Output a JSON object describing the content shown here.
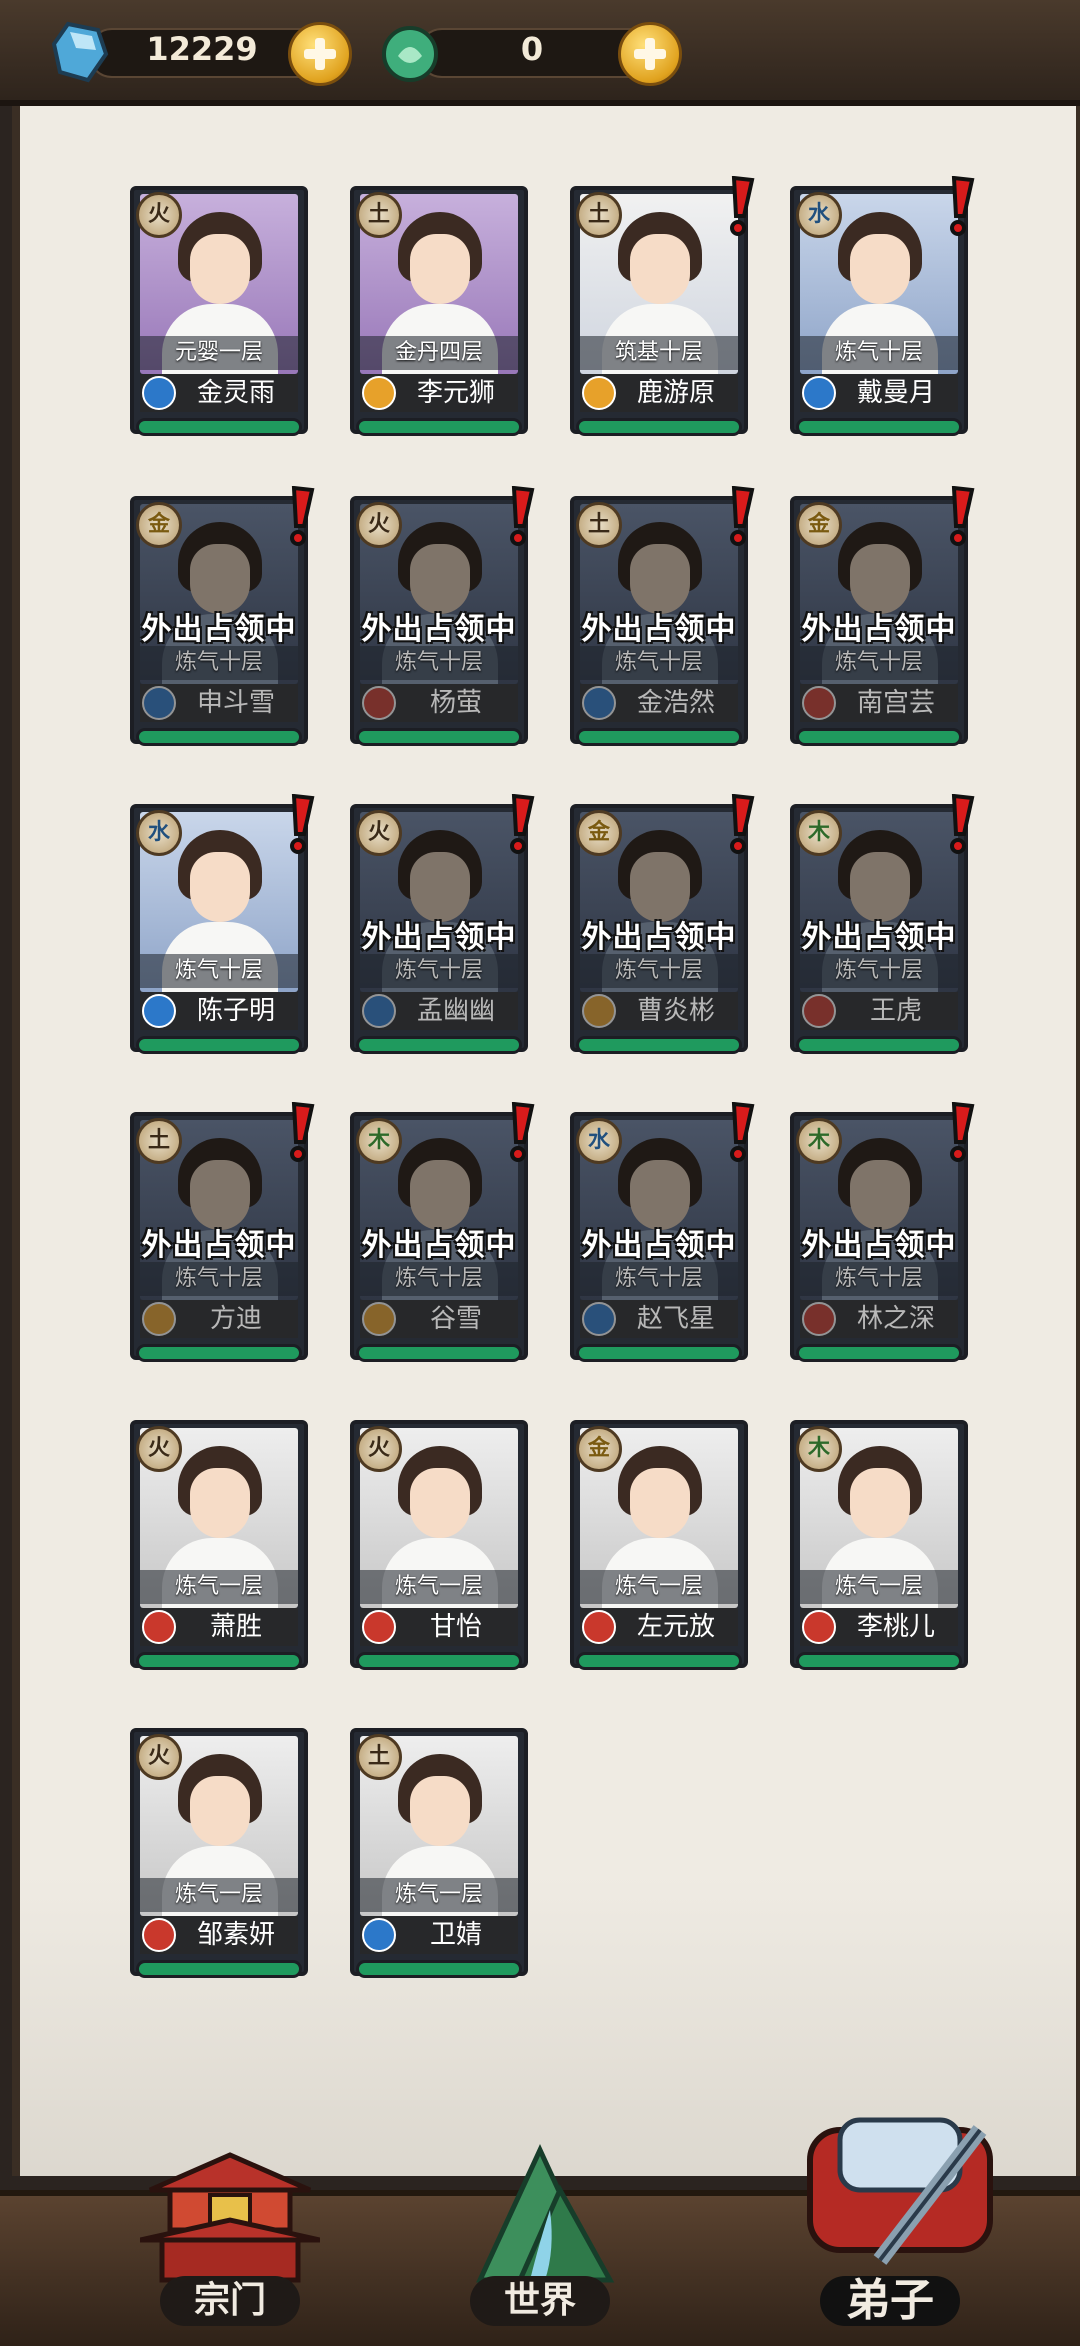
{
  "currency": {
    "jade_value": "12229",
    "jade_icon": "blue-crystal-icon",
    "gem_value": "0",
    "gem_icon": "green-egg-icon"
  },
  "disciples": [
    {
      "name": "金灵雨",
      "realm": "元婴一层",
      "element": "火",
      "element_kind": "fire",
      "sect": "blue",
      "bg": "purple",
      "status": "",
      "alert": false,
      "dimmed": false
    },
    {
      "name": "李元狮",
      "realm": "金丹四层",
      "element": "土",
      "element_kind": "earth",
      "sect": "gold",
      "bg": "purple",
      "status": "",
      "alert": false,
      "dimmed": false
    },
    {
      "name": "鹿游原",
      "realm": "筑基十层",
      "element": "土",
      "element_kind": "earth",
      "sect": "gold",
      "bg": "white",
      "status": "",
      "alert": true,
      "dimmed": false
    },
    {
      "name": "戴曼月",
      "realm": "炼气十层",
      "element": "水",
      "element_kind": "water",
      "sect": "blue",
      "bg": "blue",
      "status": "",
      "alert": true,
      "dimmed": false
    },
    {
      "name": "申斗雪",
      "realm": "炼气十层",
      "element": "金",
      "element_kind": "metal",
      "sect": "blue",
      "bg": "dark",
      "status": "外出占领中",
      "alert": true,
      "dimmed": true
    },
    {
      "name": "杨萤",
      "realm": "炼气十层",
      "element": "火",
      "element_kind": "fire",
      "sect": "red",
      "bg": "dark",
      "status": "外出占领中",
      "alert": true,
      "dimmed": true
    },
    {
      "name": "金浩然",
      "realm": "炼气十层",
      "element": "土",
      "element_kind": "earth",
      "sect": "blue",
      "bg": "dark",
      "status": "外出占领中",
      "alert": true,
      "dimmed": true
    },
    {
      "name": "南宫芸",
      "realm": "炼气十层",
      "element": "金",
      "element_kind": "metal",
      "sect": "red",
      "bg": "dark",
      "status": "外出占领中",
      "alert": true,
      "dimmed": true
    },
    {
      "name": "陈子明",
      "realm": "炼气十层",
      "element": "水",
      "element_kind": "water",
      "sect": "blue",
      "bg": "blue",
      "status": "",
      "alert": true,
      "dimmed": false
    },
    {
      "name": "孟幽幽",
      "realm": "炼气十层",
      "element": "火",
      "element_kind": "fire",
      "sect": "blue",
      "bg": "dark",
      "status": "外出占领中",
      "alert": true,
      "dimmed": true
    },
    {
      "name": "曹炎彬",
      "realm": "炼气十层",
      "element": "金",
      "element_kind": "metal",
      "sect": "gold",
      "bg": "dark",
      "status": "外出占领中",
      "alert": true,
      "dimmed": true
    },
    {
      "name": "王虎",
      "realm": "炼气十层",
      "element": "木",
      "element_kind": "wood",
      "sect": "red",
      "bg": "dark",
      "status": "外出占领中",
      "alert": true,
      "dimmed": true
    },
    {
      "name": "方迪",
      "realm": "炼气十层",
      "element": "土",
      "element_kind": "earth",
      "sect": "gold",
      "bg": "dark",
      "status": "外出占领中",
      "alert": true,
      "dimmed": true
    },
    {
      "name": "谷雪",
      "realm": "炼气十层",
      "element": "木",
      "element_kind": "wood",
      "sect": "gold",
      "bg": "dark",
      "status": "外出占领中",
      "alert": true,
      "dimmed": true
    },
    {
      "name": "赵飞星",
      "realm": "炼气十层",
      "element": "水",
      "element_kind": "water",
      "sect": "blue",
      "bg": "dark",
      "status": "外出占领中",
      "alert": true,
      "dimmed": true
    },
    {
      "name": "林之深",
      "realm": "炼气十层",
      "element": "木",
      "element_kind": "wood",
      "sect": "red",
      "bg": "dark",
      "status": "外出占领中",
      "alert": true,
      "dimmed": true
    },
    {
      "name": "萧胜",
      "realm": "炼气一层",
      "element": "火",
      "element_kind": "fire",
      "sect": "red",
      "bg": "grey",
      "status": "",
      "alert": false,
      "dimmed": false
    },
    {
      "name": "甘怡",
      "realm": "炼气一层",
      "element": "火",
      "element_kind": "fire",
      "sect": "red",
      "bg": "grey",
      "status": "",
      "alert": false,
      "dimmed": false
    },
    {
      "name": "左元放",
      "realm": "炼气一层",
      "element": "金",
      "element_kind": "metal",
      "sect": "red",
      "bg": "grey",
      "status": "",
      "alert": false,
      "dimmed": false
    },
    {
      "name": "李桃儿",
      "realm": "炼气一层",
      "element": "木",
      "element_kind": "wood",
      "sect": "red",
      "bg": "grey",
      "status": "",
      "alert": false,
      "dimmed": false
    },
    {
      "name": "邹素妍",
      "realm": "炼气一层",
      "element": "火",
      "element_kind": "fire",
      "sect": "red",
      "bg": "grey",
      "status": "",
      "alert": false,
      "dimmed": false
    },
    {
      "name": "卫婧",
      "realm": "炼气一层",
      "element": "土",
      "element_kind": "earth",
      "sect": "blue",
      "bg": "grey",
      "status": "",
      "alert": false,
      "dimmed": false
    }
  ],
  "nav": {
    "sect_label": "宗门",
    "sect_icon": "pagoda-icon",
    "world_label": "世界",
    "world_icon": "mountain-icon",
    "disciples_label": "弟子",
    "disciples_icon": "scroll-sword-icon",
    "active": "disciples"
  },
  "colors": {
    "panel_bg": "#efebe3",
    "hp_green": "#1f9a5e",
    "alert_red": "#d81b1b",
    "frame_dark": "#252a33"
  }
}
